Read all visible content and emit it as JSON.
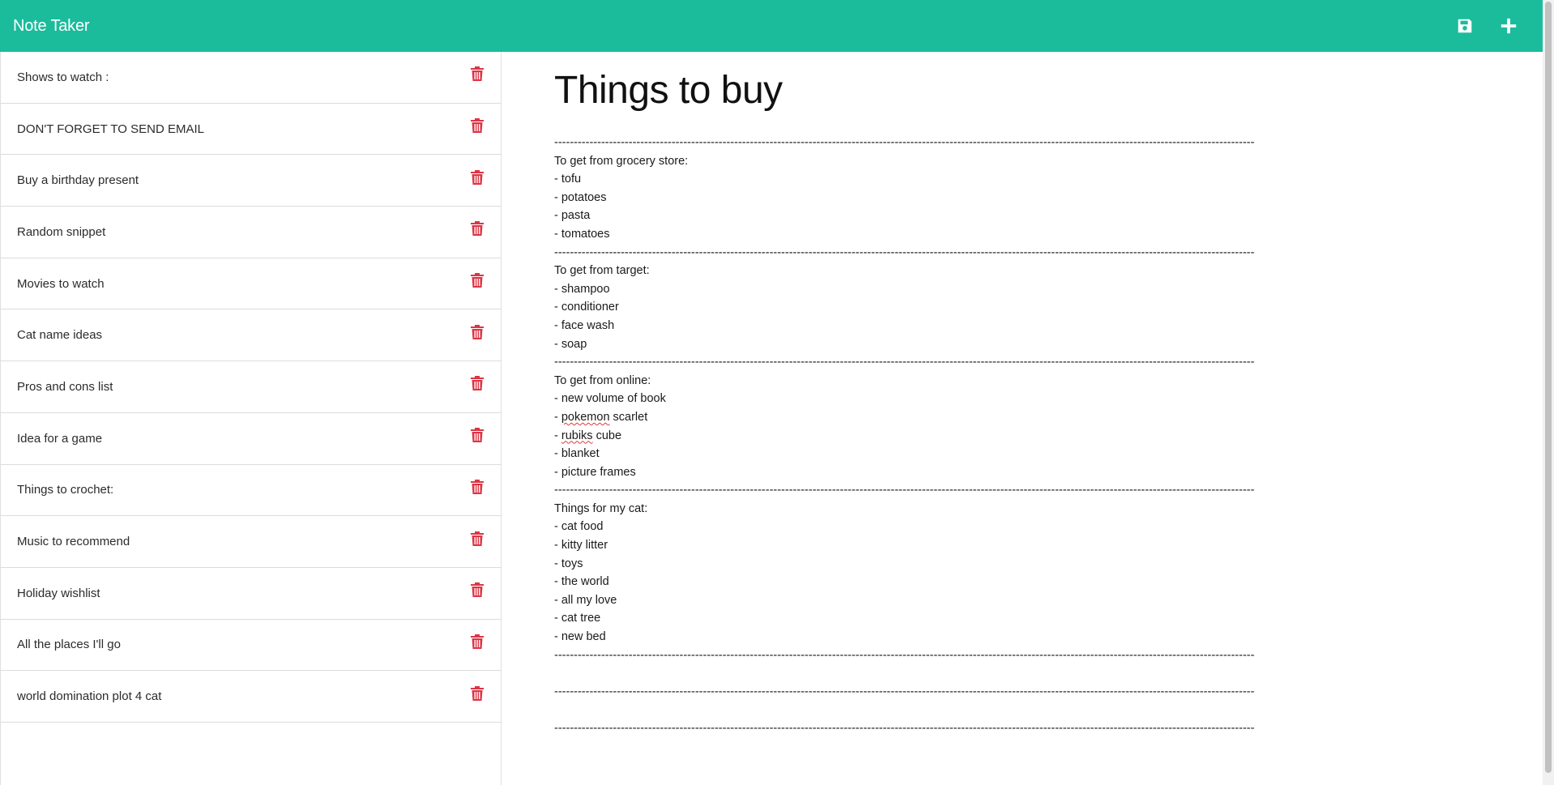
{
  "app": {
    "title": "Note Taker",
    "accent_color": "#1abc9c",
    "delete_color": "#dc3545",
    "icons": {
      "save": "floppy-disk-icon",
      "new": "plus-icon",
      "delete": "trash-icon"
    }
  },
  "sidebar": {
    "notes": [
      {
        "title": "Shows to watch :"
      },
      {
        "title": "DON'T FORGET TO SEND EMAIL"
      },
      {
        "title": "Buy a birthday present"
      },
      {
        "title": "Random snippet"
      },
      {
        "title": "Movies to watch"
      },
      {
        "title": "Cat name ideas"
      },
      {
        "title": "Pros and cons list"
      },
      {
        "title": "Idea for a game"
      },
      {
        "title": "Things to crochet:"
      },
      {
        "title": "Music to recommend"
      },
      {
        "title": "Holiday wishlist"
      },
      {
        "title": "All the places I'll go"
      },
      {
        "title": "world domination plot 4 cat"
      }
    ]
  },
  "editor": {
    "title": "Things to buy",
    "body_lines": [
      "-----------------------------------------------------------------------------------------------------------------------------------------------------------------------------------",
      "To get from grocery store:",
      "- tofu",
      "- potatoes",
      "- pasta",
      "- tomatoes",
      "-----------------------------------------------------------------------------------------------------------------------------------------------------------------------------------",
      "To get from target:",
      "- shampoo",
      "- conditioner",
      "- face wash",
      "- soap",
      "-----------------------------------------------------------------------------------------------------------------------------------------------------------------------------------",
      "To get from online:",
      "- new volume of book",
      "- pokemon scarlet",
      "- rubiks cube",
      "- blanket",
      "- picture frames",
      "-----------------------------------------------------------------------------------------------------------------------------------------------------------------------------------",
      "Things for my cat:",
      "- cat food",
      "- kitty litter",
      "- toys",
      "- the world",
      "- all my love",
      "- cat tree",
      "- new bed",
      "-----------------------------------------------------------------------------------------------------------------------------------------------------------------------------------",
      "",
      "-----------------------------------------------------------------------------------------------------------------------------------------------------------------------------------",
      "",
      "-----------------------------------------------------------------------------------------------------------------------------------------------------------------------------------"
    ],
    "misspelled_words": [
      "pokemon",
      "rubiks"
    ]
  }
}
